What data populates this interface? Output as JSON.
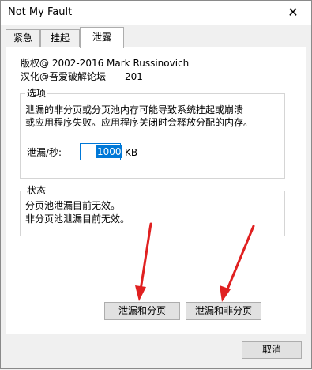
{
  "window": {
    "title": "Not My Fault",
    "close_glyph": "✕"
  },
  "tabs": [
    {
      "label": "紧急"
    },
    {
      "label": "挂起"
    },
    {
      "label": "泄露"
    }
  ],
  "about": {
    "copyright": "版权@ 2002-2016 Mark Russinovich",
    "translator": "汉化@吾爱破解论坛——201"
  },
  "options": {
    "title": "选项",
    "description_line1": "泄漏的非分页或分页池内存可能导致系统挂起或崩溃",
    "description_line2": "或应用程序失败。应用程序关闭时会释放分配的内存。",
    "rate_label": "泄漏/秒:",
    "rate_value": "1000",
    "rate_unit": "KB"
  },
  "status": {
    "title": "状态",
    "paged_status": "分页池泄漏目前无效。",
    "nonpaged_status": "非分页池泄漏目前无效。"
  },
  "buttons": {
    "leak_paged": "泄漏和分页",
    "leak_nonpaged": "泄漏和非分页",
    "cancel": "取消"
  },
  "annotations": {
    "arrow_color": "#e02020"
  }
}
